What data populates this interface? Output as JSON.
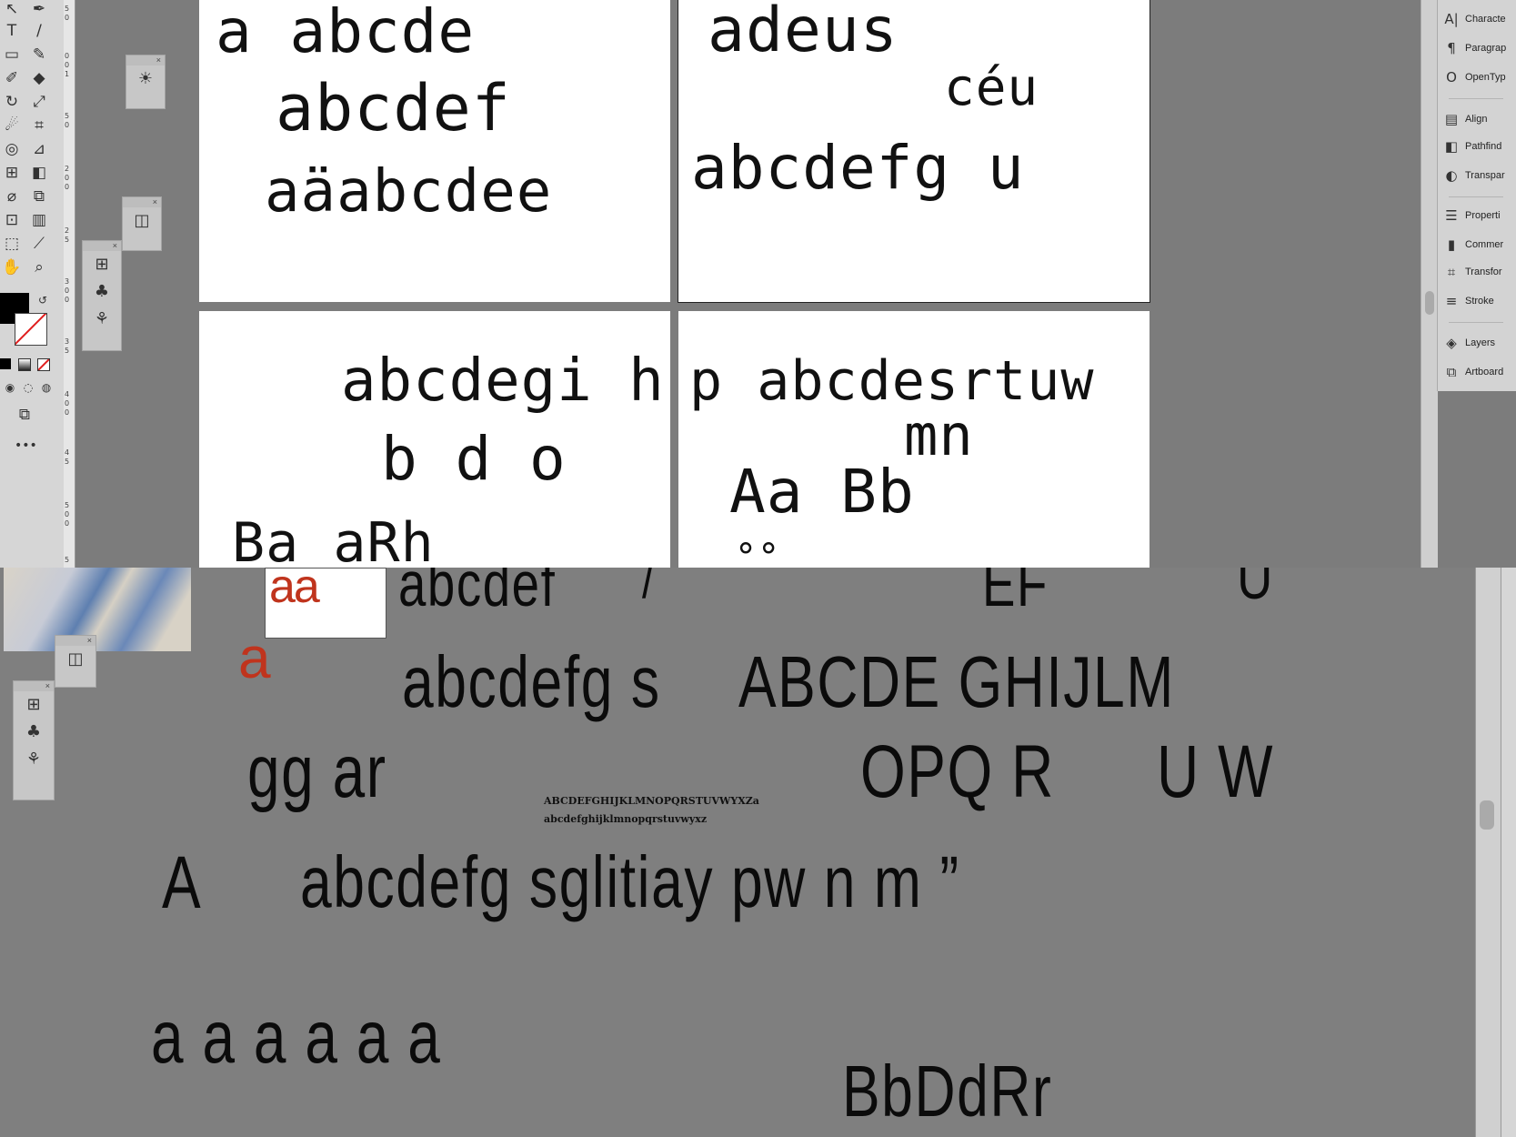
{
  "top_panel": {
    "right_panel_items": [
      {
        "icon": "A|",
        "label": "Characte"
      },
      {
        "icon": "¶",
        "label": "Paragrap"
      },
      {
        "icon": "O",
        "label": "OpenTyp"
      },
      {
        "icon": "▤",
        "label": "Align"
      },
      {
        "icon": "◧",
        "label": "Pathfind"
      },
      {
        "icon": "◐",
        "label": "Transpar"
      },
      {
        "icon": "☰",
        "label": "Properti"
      },
      {
        "icon": "▮",
        "label": "Commer"
      },
      {
        "icon": "⌗",
        "label": "Transfor"
      },
      {
        "icon": "≡",
        "label": "Stroke"
      },
      {
        "icon": "◈",
        "label": "Layers"
      },
      {
        "icon": "⧉",
        "label": "Artboard"
      }
    ],
    "ruler_marks": [
      "5",
      "0",
      "1",
      "0",
      "0",
      "1",
      "5",
      "0",
      "2",
      "0",
      "0",
      "2",
      "5",
      "0",
      "3",
      "0",
      "0",
      "3",
      "5",
      "0",
      "4",
      "0",
      "0",
      "4",
      "5",
      "0",
      "5",
      "0",
      "0",
      "5"
    ],
    "artboards": {
      "ab1": {
        "line1": "a abcde",
        "line2": "abcdef",
        "line3": "aäabcdee"
      },
      "ab2": {
        "line1": "adeus",
        "line2": "céu",
        "line3": "abcdefg u"
      },
      "ab3": {
        "line1": "abcdegi h",
        "line2": "b d o",
        "line3": "Ba aRh"
      },
      "ab4": {
        "line1": "p abcdesrtuw",
        "line2": "mn",
        "line3": "Aa Bb",
        "line4": "°°"
      }
    }
  },
  "bottom_panel": {
    "top_cut": {
      "a": "abcdef",
      "b": "EF",
      "c": "U",
      "d": "/"
    },
    "red_box_letters": "aa",
    "red_a": "a",
    "line1": {
      "a": "abcdefg s",
      "b": "ABCDE GHIJLM"
    },
    "line2": {
      "a": "gg ar",
      "b": "OPQ R",
      "c": "U W"
    },
    "small_caps": "ABCDEFGHIJKLMNOPQRSTUVWYXZa",
    "small_lower": "abcdefghijklmnopqrstuvwyxz",
    "line3": {
      "a": "A",
      "b": "abcdefg sglitiay pw n m ”"
    },
    "line4": "a a a a a a",
    "line5": "BbDdRr"
  }
}
